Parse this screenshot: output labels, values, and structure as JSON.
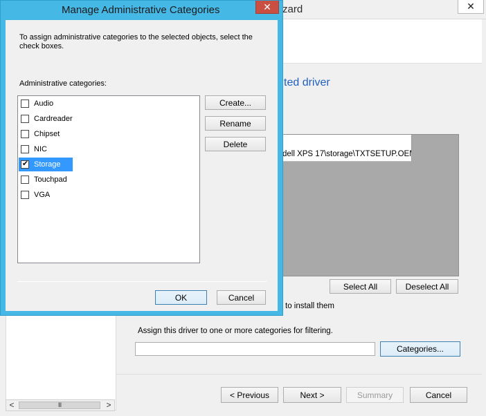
{
  "wizard": {
    "title_fragment": "zard",
    "close_glyph": "✕",
    "heading_fragment": "ted driver",
    "driver_path_fragment": "dell XPS 17\\storage\\TXTSETUP.OEM",
    "select_all_label": "Select All",
    "deselect_all_label": "Deselect All",
    "install_hint_fragment": "to install them",
    "assign_text": "Assign this driver to one or more categories for filtering.",
    "categories_field_value": "",
    "categories_button_label": "Categories...",
    "scroll_left": "<",
    "scroll_right": ">",
    "scroll_thumb_grip": "III",
    "footer": {
      "previous_label": "< Previous",
      "next_label": "Next >",
      "summary_label": "Summary",
      "cancel_label": "Cancel"
    }
  },
  "dialog": {
    "title": "Manage Administrative Categories",
    "close_glyph": "✕",
    "description": "To assign administrative categories to the selected objects, select the check boxes.",
    "list_label": "Administrative categories:",
    "categories": [
      {
        "label": "Audio",
        "checked": false
      },
      {
        "label": "Cardreader",
        "checked": false
      },
      {
        "label": "Chipset",
        "checked": false
      },
      {
        "label": "NIC",
        "checked": false
      },
      {
        "label": "Storage",
        "checked": true,
        "selected": true
      },
      {
        "label": "Touchpad",
        "checked": false
      },
      {
        "label": "VGA",
        "checked": false
      }
    ],
    "create_label": "Create...",
    "rename_label": "Rename",
    "delete_label": "Delete",
    "ok_label": "OK",
    "cancel_label": "Cancel",
    "check_glyph": "✔"
  },
  "colors": {
    "dialog_frame": "#46b8e6",
    "selection": "#3399ff",
    "close_red": "#c94f43",
    "heading_blue": "#1f5fbf"
  }
}
